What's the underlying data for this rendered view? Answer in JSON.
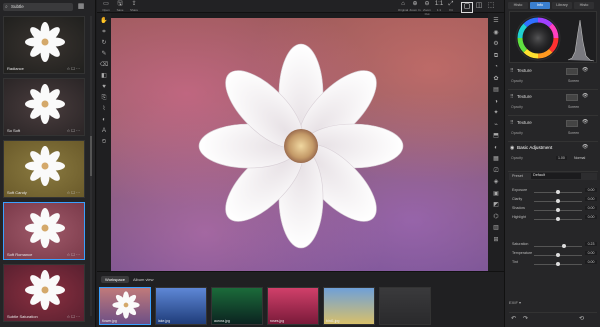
{
  "presets_panel": {
    "search_value": "Subtle",
    "items": [
      {
        "label": "Radiance",
        "fav": "☆ ☐ ···",
        "colors": [
          "#20201e",
          "#3a3430"
        ]
      },
      {
        "label": "So Soft",
        "fav": "☆ ☐ ···",
        "colors": [
          "#2a2526",
          "#4a3d3e"
        ]
      },
      {
        "label": "Soft Candy",
        "fav": "☆ ☐ ···",
        "colors": [
          "#6a5a2a",
          "#8a7a40"
        ]
      },
      {
        "label": "Soft Romance",
        "fav": "☆ ☐ ···",
        "colors": [
          "#7a3a4a",
          "#a05a6a"
        ]
      },
      {
        "label": "Subtle Saturation",
        "fav": "☆ ☐ ···",
        "colors": [
          "#5a2030",
          "#8a3040"
        ]
      }
    ]
  },
  "toolbar": {
    "left_buttons": [
      {
        "icon": "▭",
        "label": "Open"
      },
      {
        "icon": "🖫",
        "label": "Save"
      },
      {
        "icon": "⇪",
        "label": "Share"
      }
    ],
    "right_buttons": [
      {
        "icon": "⌂",
        "label": "Original"
      },
      {
        "icon": "⊕",
        "label": "Zoom In"
      },
      {
        "icon": "⊖",
        "label": "Zoom Out"
      },
      {
        "icon": "1:1",
        "label": "1:1"
      },
      {
        "icon": "⤢",
        "label": "Fit"
      }
    ],
    "view_buttons": [
      "▢",
      "◫",
      "⬚"
    ]
  },
  "bottom": {
    "tabs": [
      "Workspace",
      "Album view"
    ],
    "files": [
      {
        "label": "flower.jpg",
        "c1": "#c07a7a",
        "c2": "#6d4f86"
      },
      {
        "label": "lake.jpg",
        "c1": "#5e87d6",
        "c2": "#1f3d7a"
      },
      {
        "label": "aurora.jpg",
        "c1": "#1b6b3a",
        "c2": "#0b2320"
      },
      {
        "label": "roses.jpg",
        "c1": "#d0406a",
        "c2": "#7a1a3a"
      },
      {
        "label": "bird1.jpg",
        "c1": "#6fa0d8",
        "c2": "#d8c06a"
      },
      {
        "label": "",
        "c1": "#3a3a3c",
        "c2": "#2a2a2c"
      }
    ]
  },
  "right_panel": {
    "tabs": [
      "Histo",
      "Info",
      "Library",
      "Histo"
    ],
    "active_tab": 1,
    "layers": [
      {
        "name": "Texture",
        "blend": "Screen",
        "opacity": "Opacity"
      },
      {
        "name": "Texture",
        "blend": "Screen",
        "opacity": "Opacity"
      },
      {
        "name": "Texture",
        "blend": "Screen",
        "opacity": "Opacity"
      }
    ],
    "basic": {
      "title": "Basic Adjustment",
      "opacity_label": "Opacity",
      "opacity_value": "1.00",
      "mode": "Normal",
      "preset_label": "Preset",
      "preset_value": "Default"
    },
    "sliders": [
      {
        "name": "Exposure",
        "value": "0.00",
        "pos": 0.5
      },
      {
        "name": "Clarity",
        "value": "0.00",
        "pos": 0.5
      },
      {
        "name": "Shadow",
        "value": "0.00",
        "pos": 0.5
      },
      {
        "name": "Highlight",
        "value": "0.00",
        "pos": 0.5
      }
    ],
    "sliders2": [
      {
        "name": "Saturation",
        "value": "0.23",
        "pos": 0.62
      },
      {
        "name": "Temperature",
        "value": "0.00",
        "pos": 0.5
      },
      {
        "name": "Tint",
        "value": "0.00",
        "pos": 0.5
      }
    ],
    "footer_text": "EXIF ▾"
  }
}
